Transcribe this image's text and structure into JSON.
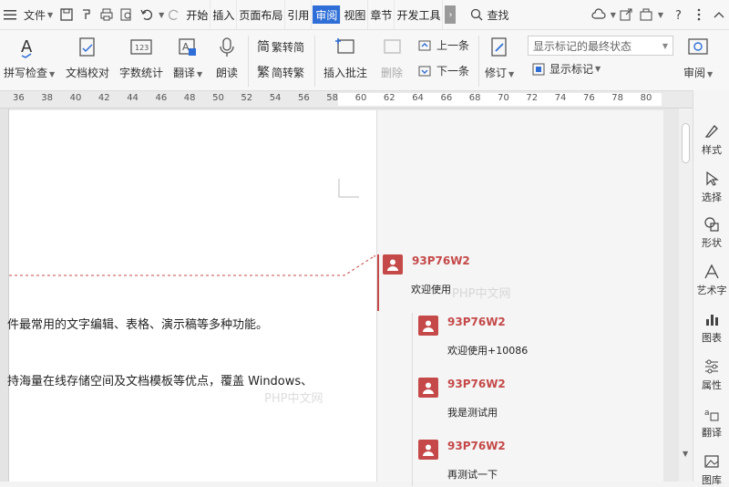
{
  "topbar": {
    "file_menu": "文件",
    "tabs": [
      "开始",
      "插入",
      "页面布局",
      "引用",
      "审阅",
      "视图",
      "章节",
      "开发工具"
    ],
    "active_tab": "审阅",
    "search": "查找"
  },
  "ribbon": {
    "spell_check": "拼写检查",
    "doc_proof": "文档校对",
    "word_count": "字数统计",
    "translate": "翻译",
    "read_aloud": "朗读",
    "trad_to_simp": "繁转简",
    "simp_to_trad": "简转繁",
    "insert_comment": "插入批注",
    "delete_comment": "删除",
    "prev_item": "上一条",
    "next_item": "下一条",
    "track_changes": "修订",
    "display_mode": "显示标记的最终状态",
    "show_markup": "显示标记",
    "review": "审阅"
  },
  "ruler": {
    "ticks": [
      "36",
      "38",
      "40",
      "42",
      "44",
      "46",
      "48",
      "50",
      "52",
      "54",
      "56",
      "58",
      "60",
      "62",
      "64",
      "66",
      "68",
      "70",
      "72",
      "74",
      "76",
      "78",
      "80"
    ]
  },
  "document": {
    "line1": "件最常用的文字编辑、表格、演示稿等多种功能。",
    "line2": "持海量在线存储空间及文档模板等优点，覆盖 Windows、"
  },
  "comments": [
    {
      "author": "93P76W2",
      "text": "欢迎使用"
    },
    {
      "author": "93P76W2",
      "text": "欢迎使用+10086"
    },
    {
      "author": "93P76W2",
      "text": "我是测试用"
    },
    {
      "author": "93P76W2",
      "text": "再测试一下"
    }
  ],
  "side_panel": [
    "样式",
    "选择",
    "形状",
    "艺术字",
    "图表",
    "属性",
    "翻译",
    "图库"
  ],
  "watermark": "PHP中文网",
  "colors": {
    "accent": "#2e6ed6",
    "comment_red": "#c54949"
  }
}
